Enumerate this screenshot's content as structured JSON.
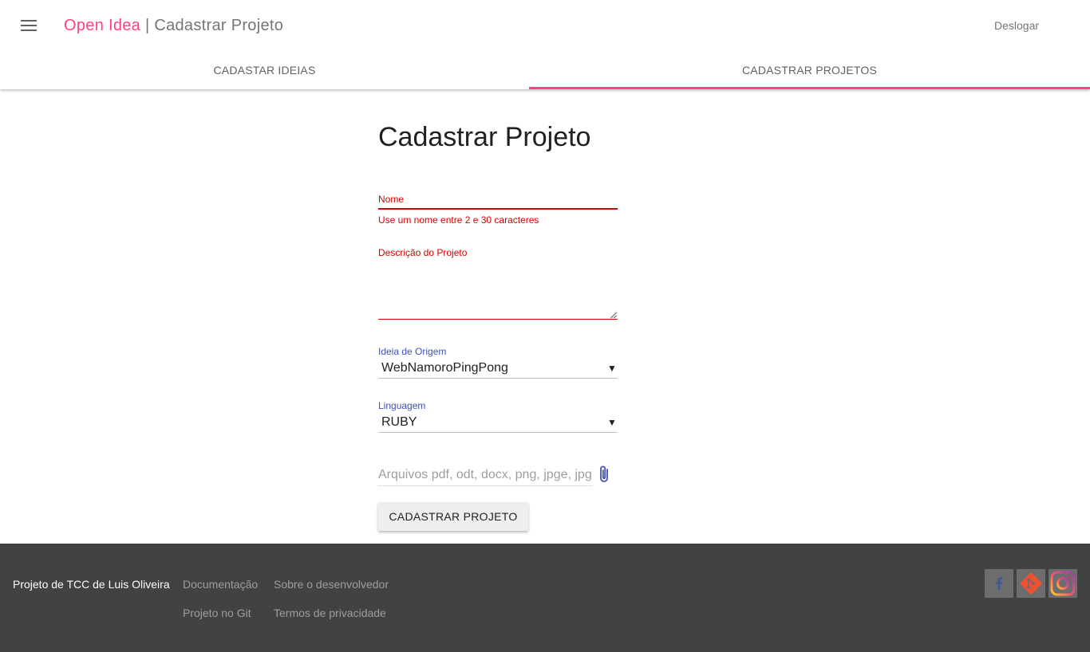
{
  "header": {
    "brand": "Open Idea",
    "separator": "|",
    "page_title": "Cadastrar Projeto",
    "logout_label": "Deslogar"
  },
  "tabs": [
    {
      "label": "CADASTAR IDEIAS",
      "active": false
    },
    {
      "label": "CADASTRAR PROJETOS",
      "active": true
    }
  ],
  "form": {
    "title": "Cadastrar Projeto",
    "nome": {
      "label": "Nome",
      "value": "",
      "error": "Use um nome entre 2 e 30 caracteres"
    },
    "descricao": {
      "label": "Descrição do Projeto",
      "value": ""
    },
    "ideia_origem": {
      "label": "Ideia de Origem",
      "selected": "WebNamoroPingPong",
      "caret": "▼"
    },
    "linguagem": {
      "label": "Linguagem",
      "selected": "RUBY",
      "caret": "▼"
    },
    "arquivos": {
      "placeholder": "Arquivos pdf, odt, docx, png, jpge, jpg",
      "icon": "attach-file-icon"
    },
    "submit_label": "CADASTRAR PROJETO"
  },
  "footer": {
    "credit": "Projeto de TCC de Luis Oliveira",
    "links": [
      "Documentação",
      "Sobre o desenvolvedor",
      "Projeto no Git",
      "Termos de privacidade"
    ],
    "social": [
      "facebook-icon",
      "git-icon",
      "instagram-icon"
    ]
  },
  "colors": {
    "accent": "#ff4081",
    "error": "#d50000",
    "primary": "#3f51b5",
    "footer_bg": "#424242"
  }
}
